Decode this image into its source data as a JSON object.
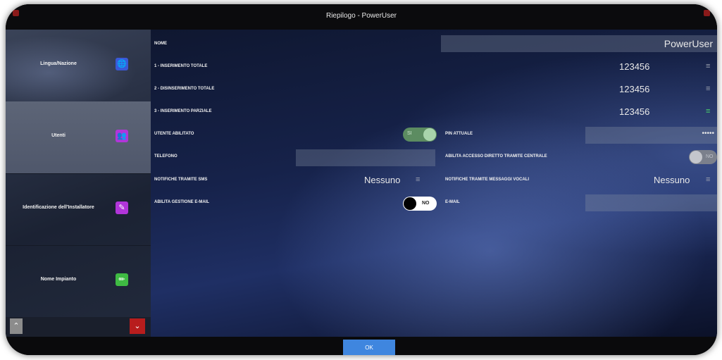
{
  "window": {
    "title": "Riepilogo - PowerUser"
  },
  "sidebar": {
    "items": [
      {
        "label": "Lingua/Nazione",
        "icon": "globe-icon"
      },
      {
        "label": "Utenti",
        "icon": "users-icon",
        "active": true
      },
      {
        "label": "Identificazione dell'Installatore",
        "icon": "installer-icon"
      },
      {
        "label": "Nome Impianto",
        "icon": "edit-icon"
      }
    ]
  },
  "form": {
    "nome_label": "NOME",
    "nome_value": "PowerUser",
    "ins_totale_label": "1 - INSERIMENTO TOTALE",
    "ins_totale_value": "123456",
    "dis_totale_label": "2 - DISINSERIMENTO TOTALE",
    "dis_totale_value": "123456",
    "ins_parziale_label": "3 - INSERIMENTO PARZIALE",
    "ins_parziale_value": "123456",
    "utente_abilitato_label": "UTENTE ABILITATO",
    "utente_abilitato_toggle": "SI",
    "pin_attuale_label": "PIN ATTUALE",
    "pin_attuale_value": "•••••",
    "telefono_label": "TELEFONO",
    "accesso_diretto_label": "ABILITA ACCESSO DIRETTO TRAMITE CENTRALE",
    "accesso_diretto_toggle": "NO",
    "notifiche_sms_label": "NOTIFICHE TRAMITE SMS",
    "notifiche_sms_value": "Nessuno",
    "notifiche_vocali_label": "NOTIFICHE TRAMITE MESSAGGI VOCALI",
    "notifiche_vocali_value": "Nessuno",
    "gestione_email_label": "ABILITA GESTIONE E-MAIL",
    "gestione_email_toggle": "NO",
    "email_label": "E-MAIL"
  },
  "footer": {
    "ok_label": "OK"
  },
  "colors": {
    "accent": "#3f86df",
    "active_toggle": "#5c8c61",
    "menu_green": "#4ad06b",
    "nav_down": "#b81d1d"
  }
}
